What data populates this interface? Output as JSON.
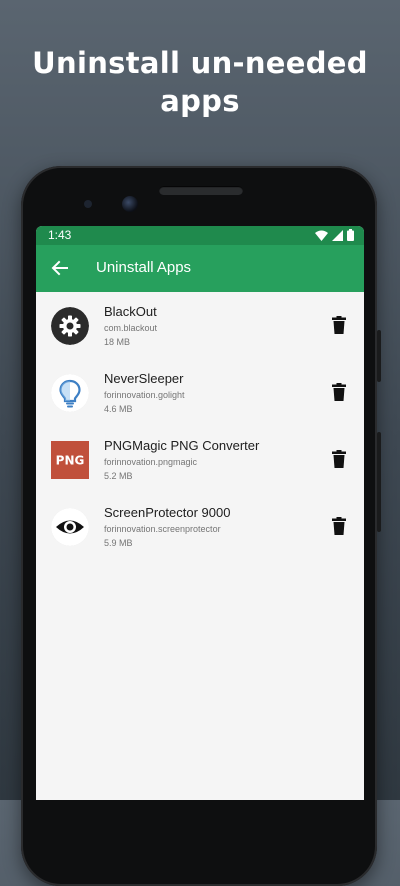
{
  "promo": {
    "headline_line1": "Uninstall un-needed",
    "headline_line2": "apps"
  },
  "status_bar": {
    "time": "1:43",
    "icons": [
      "wifi-icon",
      "signal-icon",
      "battery-icon"
    ]
  },
  "app_bar": {
    "title": "Uninstall Apps",
    "back_icon": "arrow-back-icon",
    "color": "#27a05d",
    "status_color": "#1f8a4d"
  },
  "apps": [
    {
      "name": "BlackOut",
      "package": "com.blackout",
      "size": "18 MB",
      "icon": "gear-icon"
    },
    {
      "name": "NeverSleeper",
      "package": "forinnovation.golight",
      "size": "4.6 MB",
      "icon": "lightbulb-icon"
    },
    {
      "name": "PNGMagic PNG Converter",
      "package": "forinnovation.pngmagic",
      "size": "5.2 MB",
      "icon": "png-icon",
      "icon_text": "PNG"
    },
    {
      "name": "ScreenProtector 9000",
      "package": "forinnovation.screenprotector",
      "size": "5.9 MB",
      "icon": "eye-icon"
    }
  ],
  "actions": {
    "delete_icon": "trash-icon"
  }
}
